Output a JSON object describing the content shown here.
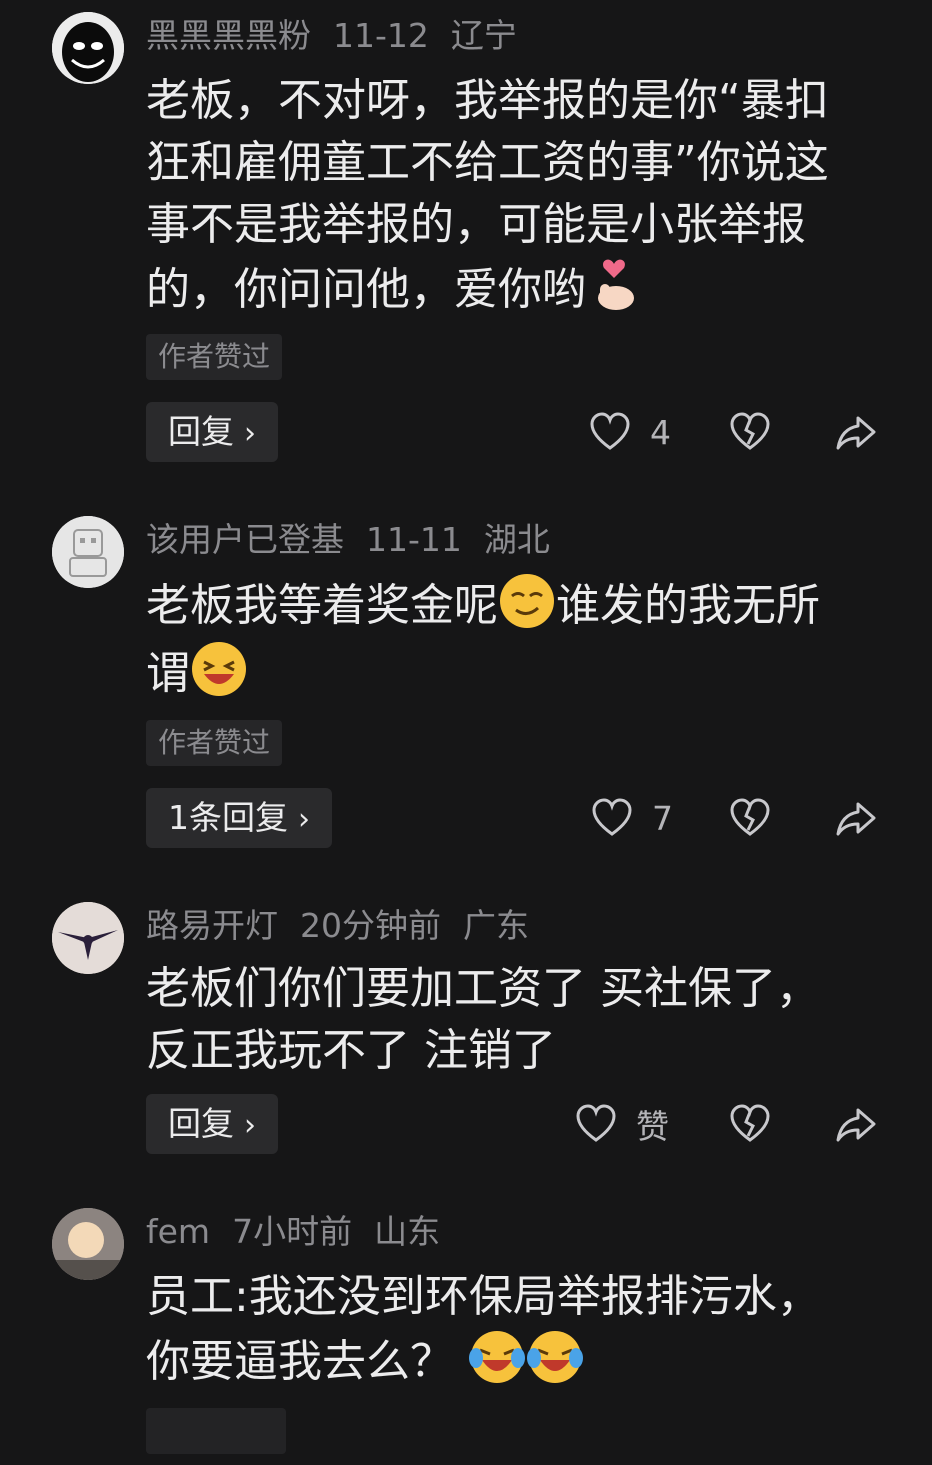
{
  "comments": [
    {
      "username": "黑黑黑黑粉",
      "time": "11-12",
      "location": "辽宁",
      "text_lines": [
        "老板，不对呀，我举报的是你“暴扣",
        "狂和雇佣童工不给工资的事”你说这",
        "事不是我举报的，可能是小张举报"
      ],
      "last_line": "的，你问问他，爱你哟",
      "emoji": "finger-heart-emoji",
      "liked_tag": "作者赞过",
      "reply_label": "回复",
      "like_count": "4"
    },
    {
      "username": "该用户已登基",
      "time": "11-11",
      "location": "湖北",
      "text_part1": "老板我等着奖金呢",
      "text_part2": "谁发的我无所",
      "text_part3": "谓",
      "emoji1": "smirk-emoji",
      "emoji2": "laughing-emoji",
      "liked_tag": "作者赞过",
      "reply_label": "1条回复",
      "like_count": "7"
    },
    {
      "username": "路易开灯",
      "time": "20分钟前",
      "location": "广东",
      "text_lines": [
        "老板们你们要加工资了 买社保了，",
        "反正我玩不了 注销了"
      ],
      "reply_label": "回复",
      "like_count": "赞"
    },
    {
      "username": "fem",
      "time": "7小时前",
      "location": "山东",
      "text_lines": [
        "员工:我还没到环保局举报排污水，"
      ],
      "last_line": "你要逼我去么？",
      "emoji": "laugh-cry-emoji"
    }
  ],
  "colors": {
    "background": "#161617",
    "muted_text": "#8b8b8f",
    "main_text": "#ececed",
    "button_bg": "#2a2a2c"
  }
}
